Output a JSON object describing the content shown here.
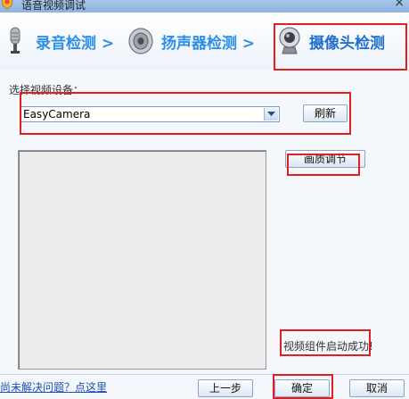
{
  "window": {
    "title": "语音视频调试",
    "close_glyph": "×",
    "app_icon": "app-shield-icon"
  },
  "steps": [
    {
      "label": "录音检测 >",
      "icon": "microphone-icon",
      "state": "inactive"
    },
    {
      "label": "扬声器检测 >",
      "icon": "speaker-icon",
      "state": "inactive"
    },
    {
      "label": "摄像头检测",
      "icon": "webcam-icon",
      "state": "active"
    }
  ],
  "device": {
    "label": "选择视频设备：",
    "selected": "EasyCamera",
    "refresh_label": "刷新"
  },
  "preview": {
    "quality_label": "画质调节"
  },
  "status_text": "视频组件启动成功!",
  "footer": {
    "help_link": "尚未解决问题？点这里",
    "prev_label": "上一步",
    "ok_label": "确定",
    "cancel_label": "取消"
  },
  "colors": {
    "accent": "#2d8ee6",
    "highlight": "#e02020",
    "link": "#1f4eb8"
  }
}
